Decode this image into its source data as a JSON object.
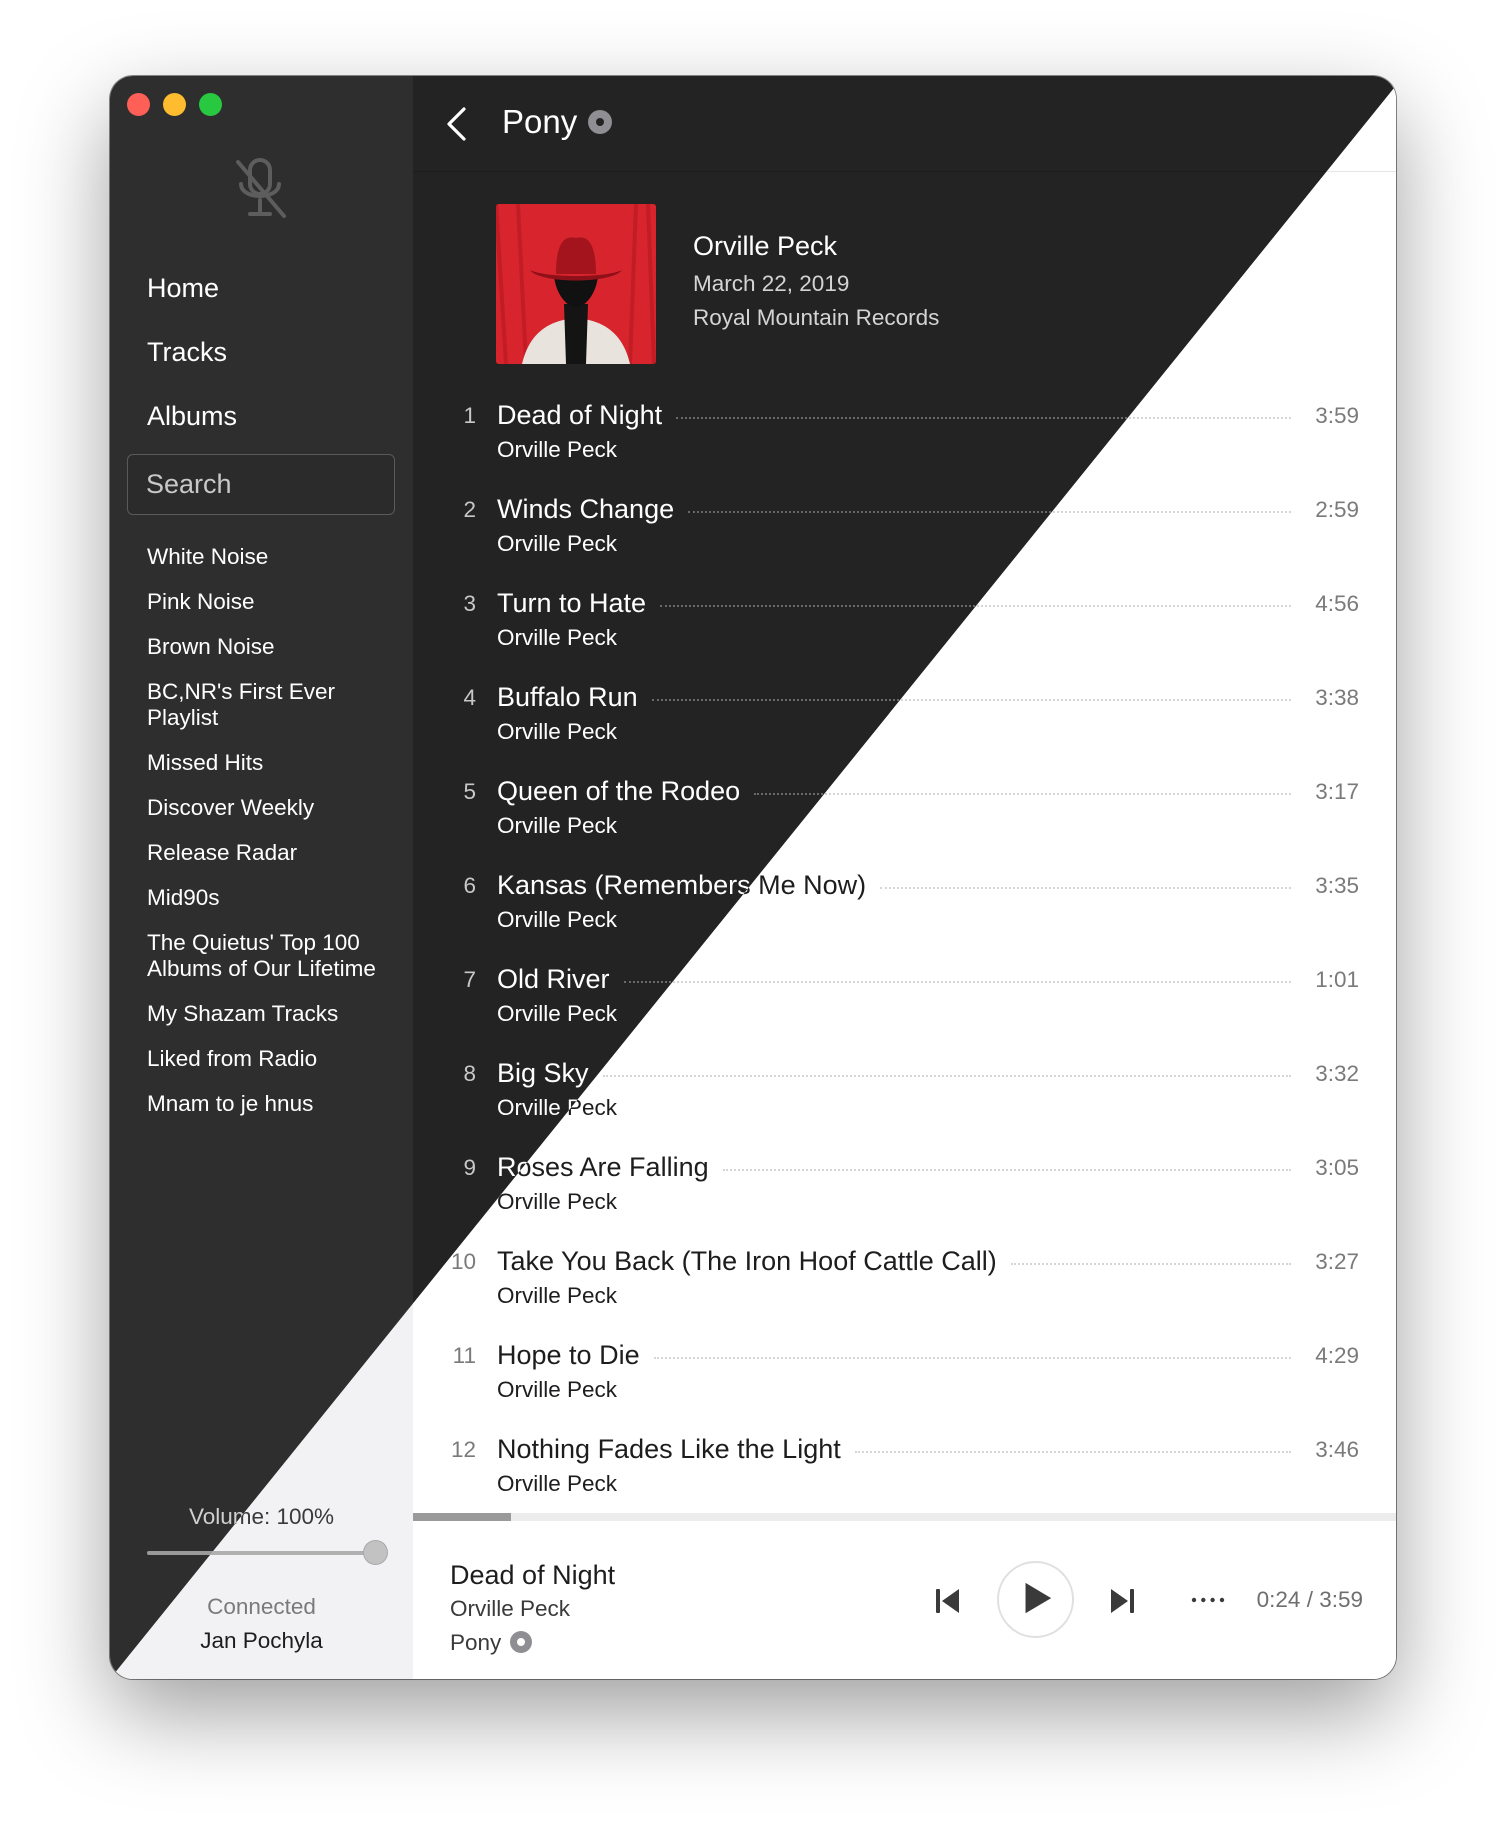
{
  "sidebar": {
    "nav": [
      {
        "label": "Home"
      },
      {
        "label": "Tracks"
      },
      {
        "label": "Albums"
      }
    ],
    "search_label": "Search",
    "playlists": [
      {
        "label": "White Noise"
      },
      {
        "label": "Pink Noise"
      },
      {
        "label": "Brown Noise"
      },
      {
        "label": "BC,NR's First Ever Playlist"
      },
      {
        "label": "Missed Hits"
      },
      {
        "label": "Discover Weekly"
      },
      {
        "label": "Release Radar"
      },
      {
        "label": "Mid90s"
      },
      {
        "label": "The Quietus' Top 100 Albums of Our Lifetime"
      },
      {
        "label": "My Shazam Tracks"
      },
      {
        "label": "Liked from Radio"
      },
      {
        "label": "Mnam to je hnus"
      }
    ],
    "volume_label": "Volume: 100%",
    "volume_level": 1.0,
    "connection_status": "Connected",
    "user_name": "Jan Pochyla"
  },
  "album": {
    "title": "Pony",
    "artist": "Orville Peck",
    "release_date": "March 22, 2019",
    "label": "Royal Mountain Records",
    "tracks": [
      {
        "number": "1",
        "title": "Dead of Night",
        "artist": "Orville Peck",
        "duration": "3:59"
      },
      {
        "number": "2",
        "title": "Winds Change",
        "artist": "Orville Peck",
        "duration": "2:59"
      },
      {
        "number": "3",
        "title": "Turn to Hate",
        "artist": "Orville Peck",
        "duration": "4:56"
      },
      {
        "number": "4",
        "title": "Buffalo Run",
        "artist": "Orville Peck",
        "duration": "3:38"
      },
      {
        "number": "5",
        "title": "Queen of the Rodeo",
        "artist": "Orville Peck",
        "duration": "3:17"
      },
      {
        "number": "6",
        "title": "Kansas (Remembers Me Now)",
        "artist": "Orville Peck",
        "duration": "3:35"
      },
      {
        "number": "7",
        "title": "Old River",
        "artist": "Orville Peck",
        "duration": "1:01"
      },
      {
        "number": "8",
        "title": "Big Sky",
        "artist": "Orville Peck",
        "duration": "3:32"
      },
      {
        "number": "9",
        "title": "Roses Are Falling",
        "artist": "Orville Peck",
        "duration": "3:05"
      },
      {
        "number": "10",
        "title": "Take You Back (The Iron Hoof Cattle Call)",
        "artist": "Orville Peck",
        "duration": "3:27"
      },
      {
        "number": "11",
        "title": "Hope to Die",
        "artist": "Orville Peck",
        "duration": "4:29"
      },
      {
        "number": "12",
        "title": "Nothing Fades Like the Light",
        "artist": "Orville Peck",
        "duration": "3:46"
      }
    ]
  },
  "now_playing": {
    "title": "Dead of Night",
    "artist": "Orville Peck",
    "album": "Pony",
    "time": "0:24 / 3:59",
    "progress": 0.1
  },
  "colors": {
    "dark_sidebar": "#2e2e2e",
    "dark_content": "#232323",
    "light_sidebar": "#f2f2f4",
    "light_content": "#ffffff",
    "album_cover_red": "#d8242c",
    "traffic_close": "#fe5f57",
    "traffic_minimize": "#febc2e",
    "traffic_maximize": "#28c840"
  },
  "icons": {
    "microphone": "microphone-slash-icon",
    "back": "chevron-left-icon",
    "disc": "disc-icon",
    "previous": "previous-track-icon",
    "play": "play-icon",
    "next": "next-track-icon",
    "more": "more-dots-icon"
  }
}
